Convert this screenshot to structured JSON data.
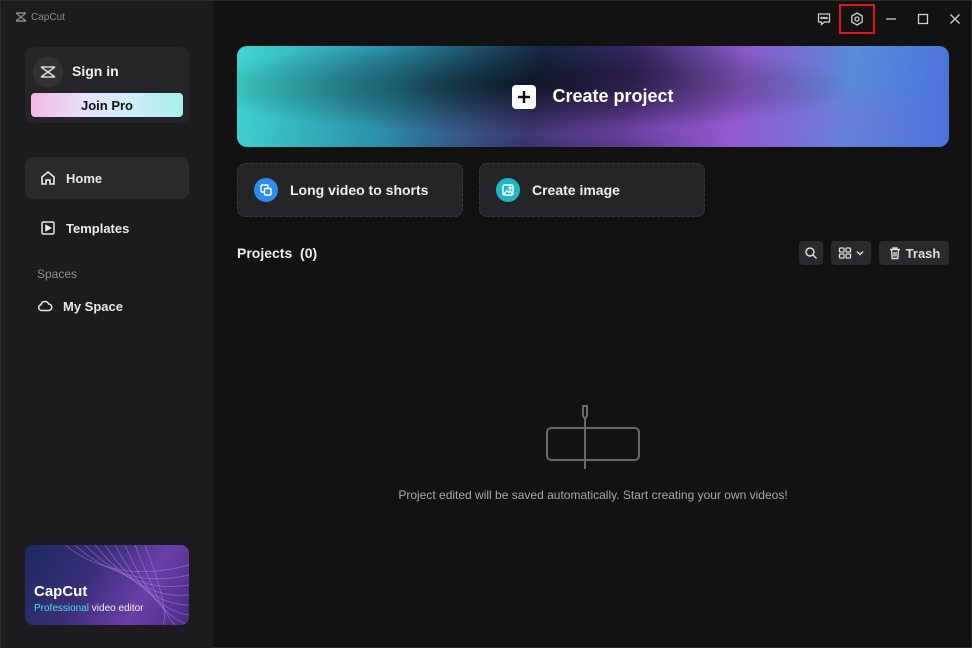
{
  "app": {
    "name": "CapCut"
  },
  "account": {
    "signin_label": "Sign in",
    "joinpro_label": "Join Pro"
  },
  "nav": {
    "home_label": "Home",
    "templates_label": "Templates",
    "spaces_label": "Spaces",
    "myspace_label": "My Space"
  },
  "promo": {
    "title": "CapCut",
    "sub_accent": "Professional",
    "sub_rest": " video editor"
  },
  "hero": {
    "label": "Create project"
  },
  "quick_actions": {
    "long_video_label": "Long video to shorts",
    "create_image_label": "Create image"
  },
  "projects": {
    "title": "Projects",
    "count": "(0)",
    "trash_label": "Trash",
    "empty_text": "Project edited will be saved automatically. Start creating your own videos!"
  },
  "colors": {
    "accent_blue": "#2d8cf0",
    "accent_teal": "#1fb5c4",
    "highlight": "#e0141e"
  }
}
